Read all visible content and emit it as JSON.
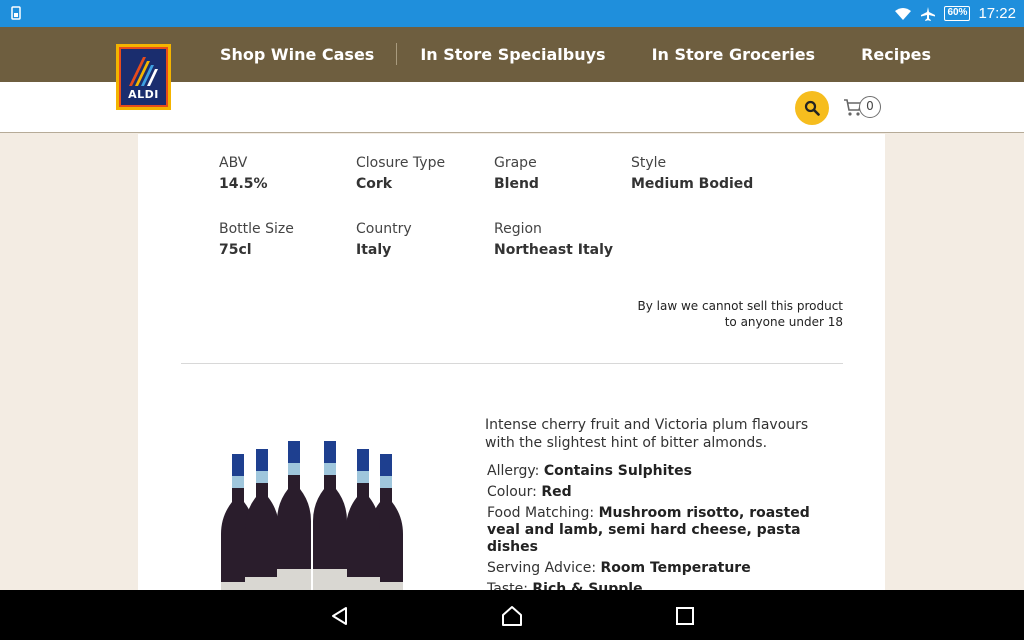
{
  "status_bar": {
    "time": "17:22",
    "battery": "60%"
  },
  "logo": {
    "text": "ALDI"
  },
  "nav": {
    "items": [
      {
        "label": "Shop Wine Cases"
      },
      {
        "label": "In Store Specialbuys"
      },
      {
        "label": "In Store Groceries"
      },
      {
        "label": "Recipes"
      }
    ]
  },
  "cart": {
    "count": "0"
  },
  "specs": [
    {
      "label": "ABV",
      "value": "14.5%"
    },
    {
      "label": "Closure Type",
      "value": "Cork"
    },
    {
      "label": "Grape",
      "value": "Blend"
    },
    {
      "label": "Style",
      "value": "Medium Bodied"
    },
    {
      "label": "Bottle Size",
      "value": "75cl"
    },
    {
      "label": "Country",
      "value": "Italy"
    },
    {
      "label": "Region",
      "value": "Northeast Italy"
    }
  ],
  "law_notice": "By law we cannot sell this product to anyone under 18",
  "product": {
    "description": "Intense cherry fruit and Victoria plum flavours with the slightest hint of bitter almonds.",
    "details": [
      {
        "label": "Allergy: ",
        "value": "Contains Sulphites"
      },
      {
        "label": "Colour: ",
        "value": "Red"
      },
      {
        "label": "Food Matching: ",
        "value": "Mushroom risotto, roasted veal and lamb, semi hard cheese, pasta dishes"
      },
      {
        "label": "Serving Advice: ",
        "value": "Room Temperature"
      },
      {
        "label": "Taste: ",
        "value": "Rich & Supple"
      }
    ]
  },
  "colors": {
    "status_bar": "#1f8fdc",
    "nav_bar": "#6e5e3f",
    "search_button": "#f6bd1e",
    "background": "#f3ece3"
  }
}
